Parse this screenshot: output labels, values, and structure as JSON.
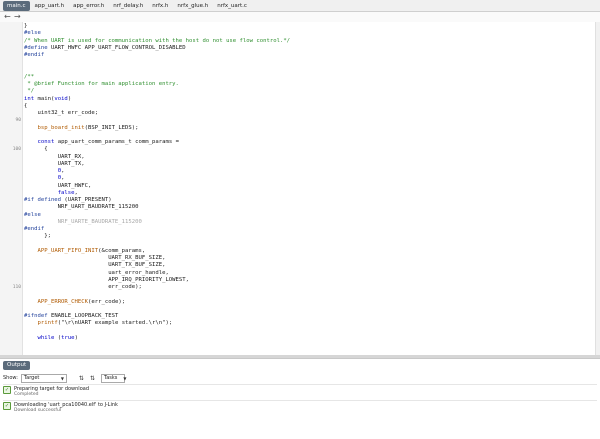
{
  "tabs": [
    "main.c",
    "app_uart.h",
    "app_error.h",
    "nrf_delay.h",
    "nrfx.h",
    "nrfx_glue.h",
    "nrfx_uart.c"
  ],
  "nav": {
    "back": "←",
    "forward": "→"
  },
  "code_lines": [
    {
      "num": "",
      "tokens": [
        {
          "t": "}",
          "c": ""
        }
      ]
    },
    {
      "num": "",
      "tokens": [
        {
          "t": "#else",
          "c": "pp"
        }
      ]
    },
    {
      "num": "",
      "tokens": [
        {
          "t": "/* When UART is used for communication with the host do not use flow control.*/",
          "c": "cm"
        }
      ]
    },
    {
      "num": "",
      "tokens": [
        {
          "t": "#define",
          "c": "pp"
        },
        {
          "t": " UART_HWFC APP_UART_FLOW_CONTROL_DISABLED",
          "c": ""
        }
      ]
    },
    {
      "num": "",
      "tokens": [
        {
          "t": "#endif",
          "c": "pp"
        }
      ]
    },
    {
      "num": "",
      "tokens": []
    },
    {
      "num": "",
      "tokens": []
    },
    {
      "num": "",
      "tokens": [
        {
          "t": "/**",
          "c": "cm"
        }
      ]
    },
    {
      "num": "",
      "tokens": [
        {
          "t": " * @brief Function for main application entry.",
          "c": "cm"
        }
      ]
    },
    {
      "num": "",
      "tokens": [
        {
          "t": " */",
          "c": "cm"
        }
      ]
    },
    {
      "num": "",
      "tokens": [
        {
          "t": "int",
          "c": "kw"
        },
        {
          "t": " main(",
          "c": ""
        },
        {
          "t": "void",
          "c": "kw"
        },
        {
          "t": ")",
          "c": ""
        }
      ]
    },
    {
      "num": "",
      "tokens": [
        {
          "t": "{",
          "c": ""
        }
      ]
    },
    {
      "num": "",
      "tokens": [
        {
          "t": "    uint32_t err_code;",
          "c": ""
        }
      ]
    },
    {
      "num": "",
      "tokens": []
    },
    {
      "num": "",
      "tokens": [
        {
          "t": "    ",
          "c": ""
        },
        {
          "t": "bsp_board_init",
          "c": "fn"
        },
        {
          "t": "(BSP_INIT_LEDS);",
          "c": ""
        }
      ]
    },
    {
      "num": "",
      "tokens": []
    },
    {
      "num": "",
      "tokens": [
        {
          "t": "    ",
          "c": ""
        },
        {
          "t": "const",
          "c": "kw"
        },
        {
          "t": " app_uart_comm_params_t comm_params =",
          "c": ""
        }
      ]
    },
    {
      "num": "",
      "tokens": [
        {
          "t": "      {",
          "c": ""
        }
      ]
    },
    {
      "num": "",
      "tokens": [
        {
          "t": "          UART_RX,",
          "c": ""
        }
      ]
    },
    {
      "num": "",
      "tokens": [
        {
          "t": "          UART_TX,",
          "c": ""
        }
      ]
    },
    {
      "num": "",
      "tokens": [
        {
          "t": "          ",
          "c": ""
        },
        {
          "t": "0",
          "c": "kw"
        },
        {
          "t": ",",
          "c": ""
        }
      ]
    },
    {
      "num": "",
      "tokens": [
        {
          "t": "          ",
          "c": ""
        },
        {
          "t": "0",
          "c": "kw"
        },
        {
          "t": ",",
          "c": ""
        }
      ]
    },
    {
      "num": "",
      "tokens": [
        {
          "t": "          UART_HWFC,",
          "c": ""
        }
      ]
    },
    {
      "num": "",
      "tokens": [
        {
          "t": "          ",
          "c": ""
        },
        {
          "t": "false",
          "c": "kw"
        },
        {
          "t": ",",
          "c": ""
        }
      ]
    },
    {
      "num": "",
      "tokens": [
        {
          "t": "#if defined",
          "c": "pp"
        },
        {
          "t": " (UART_PRESENT)",
          "c": ""
        }
      ]
    },
    {
      "num": "",
      "tokens": [
        {
          "t": "          NRF_UART_BAUDRATE_115200",
          "c": ""
        }
      ]
    },
    {
      "num": "",
      "tokens": [
        {
          "t": "#else",
          "c": "pp"
        }
      ]
    },
    {
      "num": "",
      "tokens": [
        {
          "t": "          NRF_UARTE_BAUDRATE_115200",
          "c": "gray"
        }
      ]
    },
    {
      "num": "",
      "tokens": [
        {
          "t": "#endif",
          "c": "pp"
        }
      ]
    },
    {
      "num": "",
      "tokens": [
        {
          "t": "      };",
          "c": ""
        }
      ]
    },
    {
      "num": "",
      "tokens": []
    },
    {
      "num": "",
      "tokens": [
        {
          "t": "    ",
          "c": ""
        },
        {
          "t": "APP_UART_FIFO_INIT",
          "c": "fn"
        },
        {
          "t": "(&comm_params,",
          "c": ""
        }
      ]
    },
    {
      "num": "",
      "tokens": [
        {
          "t": "                         UART_RX_BUF_SIZE,",
          "c": ""
        }
      ]
    },
    {
      "num": "",
      "tokens": [
        {
          "t": "                         UART_TX_BUF_SIZE,",
          "c": ""
        }
      ]
    },
    {
      "num": "",
      "tokens": [
        {
          "t": "                         uart_error_handle,",
          "c": ""
        }
      ]
    },
    {
      "num": "",
      "tokens": [
        {
          "t": "                         APP_IRQ_PRIORITY_LOWEST,",
          "c": ""
        }
      ]
    },
    {
      "num": "",
      "tokens": [
        {
          "t": "                         err_code);",
          "c": ""
        }
      ]
    },
    {
      "num": "",
      "tokens": []
    },
    {
      "num": "",
      "tokens": [
        {
          "t": "    ",
          "c": ""
        },
        {
          "t": "APP_ERROR_CHECK",
          "c": "fn"
        },
        {
          "t": "(err_code);",
          "c": ""
        }
      ]
    },
    {
      "num": "",
      "tokens": []
    },
    {
      "num": "",
      "tokens": [
        {
          "t": "#ifndef",
          "c": "pp"
        },
        {
          "t": " ENABLE_LOOPBACK_TEST",
          "c": ""
        }
      ]
    },
    {
      "num": "",
      "tokens": [
        {
          "t": "    ",
          "c": ""
        },
        {
          "t": "printf",
          "c": "fn"
        },
        {
          "t": "(\"\\r\\nUART example started.\\r\\n\");",
          "c": ""
        }
      ]
    },
    {
      "num": "",
      "tokens": []
    },
    {
      "num": "",
      "tokens": [
        {
          "t": "    ",
          "c": ""
        },
        {
          "t": "while",
          "c": "kw"
        },
        {
          "t": " (",
          "c": ""
        },
        {
          "t": "true",
          "c": "kw"
        },
        {
          "t": ")",
          "c": ""
        }
      ]
    }
  ],
  "line_number_marks": [
    {
      "line": 13,
      "label": "90"
    },
    {
      "line": 17,
      "label": "100"
    },
    {
      "line": 36,
      "label": "110"
    },
    {
      "line": 49,
      "label": "120"
    }
  ],
  "output": {
    "tab_label": "Output",
    "show_label": "Show:",
    "show_value": "Target",
    "tasks_value": "Tasks",
    "messages": [
      {
        "title": "Preparing target for download",
        "status": "Completed"
      },
      {
        "title": "Downloading 'uart_pca10040.elf' to J-Link",
        "status": "Download successful"
      }
    ]
  }
}
